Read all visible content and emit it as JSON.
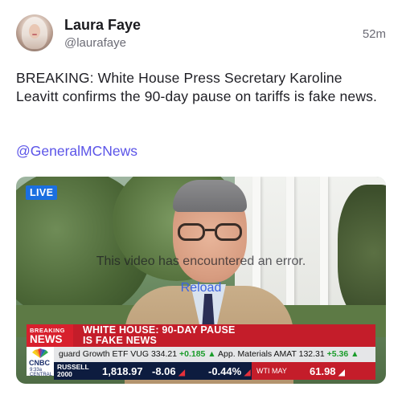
{
  "post": {
    "author_name": "Laura Faye",
    "author_handle": "@laurafaye",
    "timestamp": "52m",
    "text": "BREAKING: White House Press Secretary Karoline Leavitt confirms the 90-day pause on tariffs is fake news.",
    "mention": "@GeneralMCNews"
  },
  "video": {
    "live_badge": "LIVE",
    "error_message": "This video has encountered an error.",
    "reload_label": "Reload",
    "lower_third": {
      "breaking_label_top": "BREAKING",
      "breaking_label_bottom": "NEWS",
      "headline_line1": "WHITE HOUSE: 90-DAY PAUSE",
      "headline_line2": "IS FAKE NEWS",
      "network": "CNBC",
      "network_time": "9:33a CENTRAL",
      "stock_ticker_part1": "guard Growth ETF VUG 334.21 ",
      "stock_ticker_up1": "+0.185 ▲",
      "stock_ticker_part2": "   App. Materials AMAT 132.31 ",
      "stock_ticker_up2": "+5.36 ▲",
      "index_label_line1": "RUSSELL",
      "index_label_line2": "2000",
      "index_value": "1,818.97",
      "index_change": "-8.06",
      "index_pct": "-0.44%",
      "commodity_label": "WTI MAY",
      "commodity_value": "61.98"
    }
  },
  "colors": {
    "mention": "#5b54e8",
    "live_badge": "#1b6fe0",
    "breaking_red": "#d8202d",
    "ticker_navy": "#0d1c3f"
  }
}
